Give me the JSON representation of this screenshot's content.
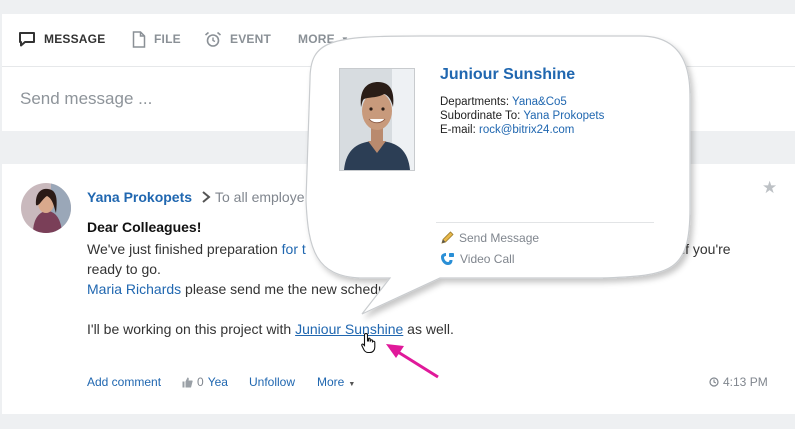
{
  "composer": {
    "tabs": [
      {
        "label": "MESSAGE",
        "icon": "message-icon"
      },
      {
        "label": "FILE",
        "icon": "file-icon"
      },
      {
        "label": "EVENT",
        "icon": "alarm-clock-icon"
      },
      {
        "label": "MORE",
        "icon": "caret-down-icon"
      }
    ],
    "placeholder": "Send message ..."
  },
  "post": {
    "author": "Yana Prokopets",
    "recipients": "To all employe",
    "greeting": "Dear Colleagues!",
    "line1_start": "We've just finished preparation ",
    "line1_link": "for t",
    "line1_end": "if you're",
    "line2": "ready to go.",
    "line3_mention": "Maria Richards",
    "line3_text": " please send me the new schedul",
    "line5_start": "I'll be working on this project with ",
    "line5_mention": "Juniour Sunshine",
    "line5_end": " as well.",
    "actions": {
      "comment": "Add comment",
      "like_count": "0",
      "like_label": "Yea",
      "unfollow": "Unfollow",
      "more": "More",
      "time": "4:13 PM"
    }
  },
  "popup": {
    "name": "Juniour Sunshine",
    "departments_label": "Departments: ",
    "departments_value": "Yana&Co5",
    "subordinate_label": "Subordinate To: ",
    "subordinate_value": "Yana Prokopets",
    "email_label": "E-mail: ",
    "email_value": "rock@bitrix24.com",
    "send_message": "Send Message",
    "video_call": "Video Call"
  },
  "colors": {
    "link": "#2067b0",
    "muted": "#80868e",
    "background": "#eef0f2",
    "arrow": "#e0199a"
  }
}
